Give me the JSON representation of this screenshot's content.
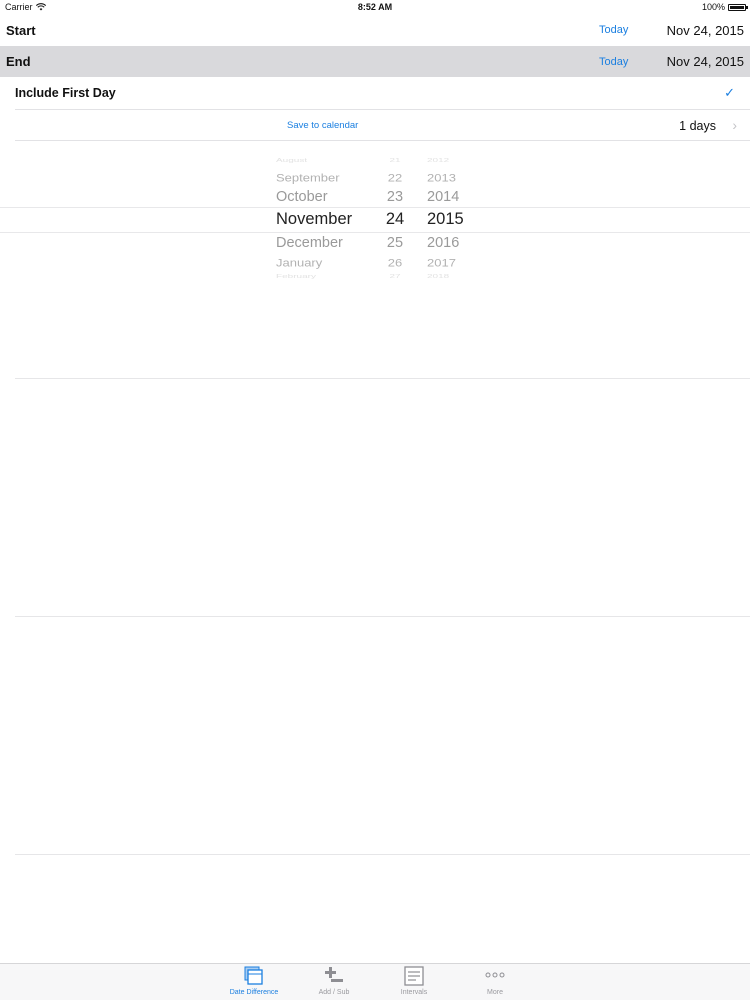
{
  "status_bar": {
    "carrier": "Carrier",
    "time": "8:52 AM",
    "battery": "100%"
  },
  "start": {
    "label": "Start",
    "today_label": "Today",
    "date": "Nov 24, 2015"
  },
  "end": {
    "label": "End",
    "today_label": "Today",
    "date": "Nov 24, 2015"
  },
  "include_first_day": {
    "label": "Include First Day",
    "checked": true,
    "check_glyph": "✓"
  },
  "result": {
    "save_label": "Save to calendar",
    "days": "1 days",
    "chevron": "›"
  },
  "picker": {
    "months": [
      "August",
      "September",
      "October",
      "November",
      "December",
      "January",
      "February"
    ],
    "days": [
      "21",
      "22",
      "23",
      "24",
      "25",
      "26",
      "27"
    ],
    "years": [
      "2012",
      "2013",
      "2014",
      "2015",
      "2016",
      "2017",
      "2018"
    ],
    "selected": {
      "month": "November",
      "day": "24",
      "year": "2015"
    }
  },
  "tabbar": {
    "tabs": [
      {
        "label": "Date Difference",
        "icon": "calendar-icon",
        "active": true
      },
      {
        "label": "Add / Sub",
        "icon": "add-subtract-icon",
        "active": false
      },
      {
        "label": "Intervals",
        "icon": "list-document-icon",
        "active": false
      },
      {
        "label": "More",
        "icon": "more-dots-icon",
        "active": false
      }
    ]
  },
  "colors": {
    "accent": "#1b7fe0",
    "selected_row_bg": "#d9d9dc",
    "separator": "#e2e2e5"
  }
}
